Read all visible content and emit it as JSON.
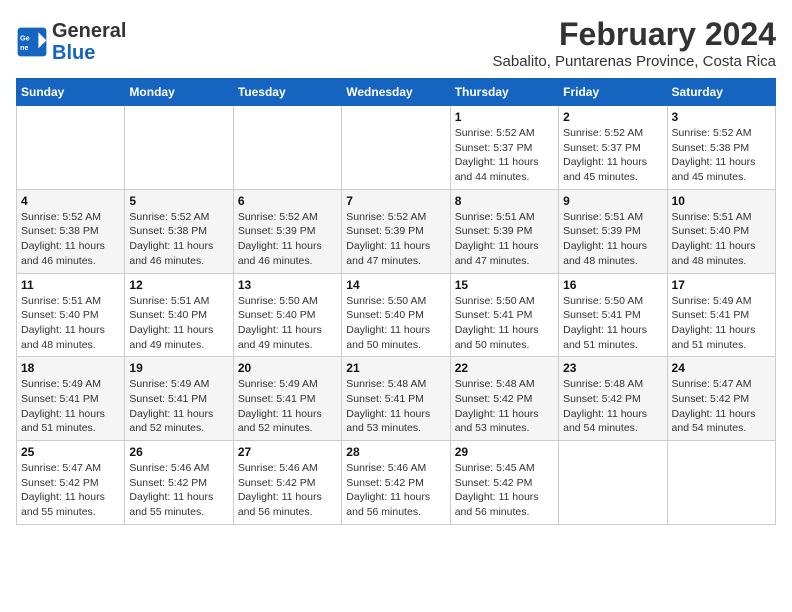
{
  "header": {
    "logo_line1": "General",
    "logo_line2": "Blue",
    "title": "February 2024",
    "subtitle": "Sabalito, Puntarenas Province, Costa Rica"
  },
  "weekdays": [
    "Sunday",
    "Monday",
    "Tuesday",
    "Wednesday",
    "Thursday",
    "Friday",
    "Saturday"
  ],
  "weeks": [
    [
      {
        "day": "",
        "info": ""
      },
      {
        "day": "",
        "info": ""
      },
      {
        "day": "",
        "info": ""
      },
      {
        "day": "",
        "info": ""
      },
      {
        "day": "1",
        "info": "Sunrise: 5:52 AM\nSunset: 5:37 PM\nDaylight: 11 hours and 44 minutes."
      },
      {
        "day": "2",
        "info": "Sunrise: 5:52 AM\nSunset: 5:37 PM\nDaylight: 11 hours and 45 minutes."
      },
      {
        "day": "3",
        "info": "Sunrise: 5:52 AM\nSunset: 5:38 PM\nDaylight: 11 hours and 45 minutes."
      }
    ],
    [
      {
        "day": "4",
        "info": "Sunrise: 5:52 AM\nSunset: 5:38 PM\nDaylight: 11 hours and 46 minutes."
      },
      {
        "day": "5",
        "info": "Sunrise: 5:52 AM\nSunset: 5:38 PM\nDaylight: 11 hours and 46 minutes."
      },
      {
        "day": "6",
        "info": "Sunrise: 5:52 AM\nSunset: 5:39 PM\nDaylight: 11 hours and 46 minutes."
      },
      {
        "day": "7",
        "info": "Sunrise: 5:52 AM\nSunset: 5:39 PM\nDaylight: 11 hours and 47 minutes."
      },
      {
        "day": "8",
        "info": "Sunrise: 5:51 AM\nSunset: 5:39 PM\nDaylight: 11 hours and 47 minutes."
      },
      {
        "day": "9",
        "info": "Sunrise: 5:51 AM\nSunset: 5:39 PM\nDaylight: 11 hours and 48 minutes."
      },
      {
        "day": "10",
        "info": "Sunrise: 5:51 AM\nSunset: 5:40 PM\nDaylight: 11 hours and 48 minutes."
      }
    ],
    [
      {
        "day": "11",
        "info": "Sunrise: 5:51 AM\nSunset: 5:40 PM\nDaylight: 11 hours and 48 minutes."
      },
      {
        "day": "12",
        "info": "Sunrise: 5:51 AM\nSunset: 5:40 PM\nDaylight: 11 hours and 49 minutes."
      },
      {
        "day": "13",
        "info": "Sunrise: 5:50 AM\nSunset: 5:40 PM\nDaylight: 11 hours and 49 minutes."
      },
      {
        "day": "14",
        "info": "Sunrise: 5:50 AM\nSunset: 5:40 PM\nDaylight: 11 hours and 50 minutes."
      },
      {
        "day": "15",
        "info": "Sunrise: 5:50 AM\nSunset: 5:41 PM\nDaylight: 11 hours and 50 minutes."
      },
      {
        "day": "16",
        "info": "Sunrise: 5:50 AM\nSunset: 5:41 PM\nDaylight: 11 hours and 51 minutes."
      },
      {
        "day": "17",
        "info": "Sunrise: 5:49 AM\nSunset: 5:41 PM\nDaylight: 11 hours and 51 minutes."
      }
    ],
    [
      {
        "day": "18",
        "info": "Sunrise: 5:49 AM\nSunset: 5:41 PM\nDaylight: 11 hours and 51 minutes."
      },
      {
        "day": "19",
        "info": "Sunrise: 5:49 AM\nSunset: 5:41 PM\nDaylight: 11 hours and 52 minutes."
      },
      {
        "day": "20",
        "info": "Sunrise: 5:49 AM\nSunset: 5:41 PM\nDaylight: 11 hours and 52 minutes."
      },
      {
        "day": "21",
        "info": "Sunrise: 5:48 AM\nSunset: 5:41 PM\nDaylight: 11 hours and 53 minutes."
      },
      {
        "day": "22",
        "info": "Sunrise: 5:48 AM\nSunset: 5:42 PM\nDaylight: 11 hours and 53 minutes."
      },
      {
        "day": "23",
        "info": "Sunrise: 5:48 AM\nSunset: 5:42 PM\nDaylight: 11 hours and 54 minutes."
      },
      {
        "day": "24",
        "info": "Sunrise: 5:47 AM\nSunset: 5:42 PM\nDaylight: 11 hours and 54 minutes."
      }
    ],
    [
      {
        "day": "25",
        "info": "Sunrise: 5:47 AM\nSunset: 5:42 PM\nDaylight: 11 hours and 55 minutes."
      },
      {
        "day": "26",
        "info": "Sunrise: 5:46 AM\nSunset: 5:42 PM\nDaylight: 11 hours and 55 minutes."
      },
      {
        "day": "27",
        "info": "Sunrise: 5:46 AM\nSunset: 5:42 PM\nDaylight: 11 hours and 56 minutes."
      },
      {
        "day": "28",
        "info": "Sunrise: 5:46 AM\nSunset: 5:42 PM\nDaylight: 11 hours and 56 minutes."
      },
      {
        "day": "29",
        "info": "Sunrise: 5:45 AM\nSunset: 5:42 PM\nDaylight: 11 hours and 56 minutes."
      },
      {
        "day": "",
        "info": ""
      },
      {
        "day": "",
        "info": ""
      }
    ]
  ]
}
